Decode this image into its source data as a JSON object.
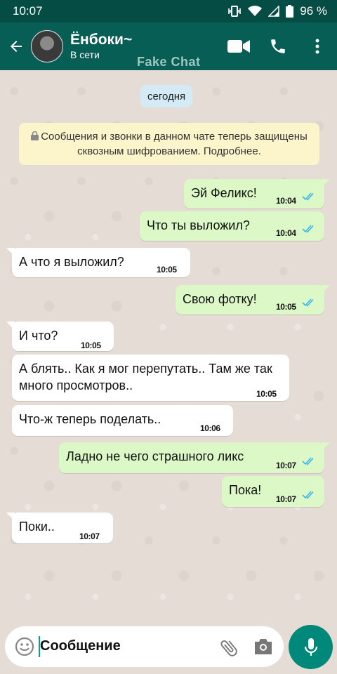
{
  "status_bar": {
    "time": "10:07",
    "battery": "96 %"
  },
  "header": {
    "contact_name": "Ёнбоки~",
    "presence": "В сети",
    "watermark": "Fake Chat"
  },
  "chat": {
    "date_chip": "сегодня",
    "system_notice": "Сообщения и звонки в данном чате теперь защищены сквозным шифрованием. Подробнее.",
    "messages": [
      {
        "direction": "out",
        "text": "Эй Феликс!",
        "time": "10:04",
        "status": "read"
      },
      {
        "direction": "out",
        "text": "Что ты выложил?",
        "time": "10:04",
        "status": "read"
      },
      {
        "direction": "in",
        "text": "А что я выложил?",
        "time": "10:05"
      },
      {
        "direction": "out",
        "text": "Свою фотку!",
        "time": "10:05",
        "status": "read"
      },
      {
        "direction": "in",
        "text": "И что?",
        "time": "10:05"
      },
      {
        "direction": "in",
        "text": "А блять.. Как я мог перепутать.. Там же так много просмотров..",
        "time": "10:05"
      },
      {
        "direction": "in",
        "text": "Что-ж теперь поделать..",
        "time": "10:06"
      },
      {
        "direction": "out",
        "text": "Ладно не чего страшного ликс",
        "time": "10:07",
        "status": "read"
      },
      {
        "direction": "out",
        "text": "Пока!",
        "time": "10:07",
        "status": "read"
      },
      {
        "direction": "in",
        "text": "Поки..",
        "time": "10:07"
      }
    ]
  },
  "composer": {
    "placeholder": "Сообщение"
  },
  "colors": {
    "header": "#075e54",
    "status_bar": "#054d44",
    "outgoing_bubble": "#dcf8c6",
    "incoming_bubble": "#ffffff",
    "read_tick": "#34b7f1",
    "mic_button": "#00897b"
  }
}
